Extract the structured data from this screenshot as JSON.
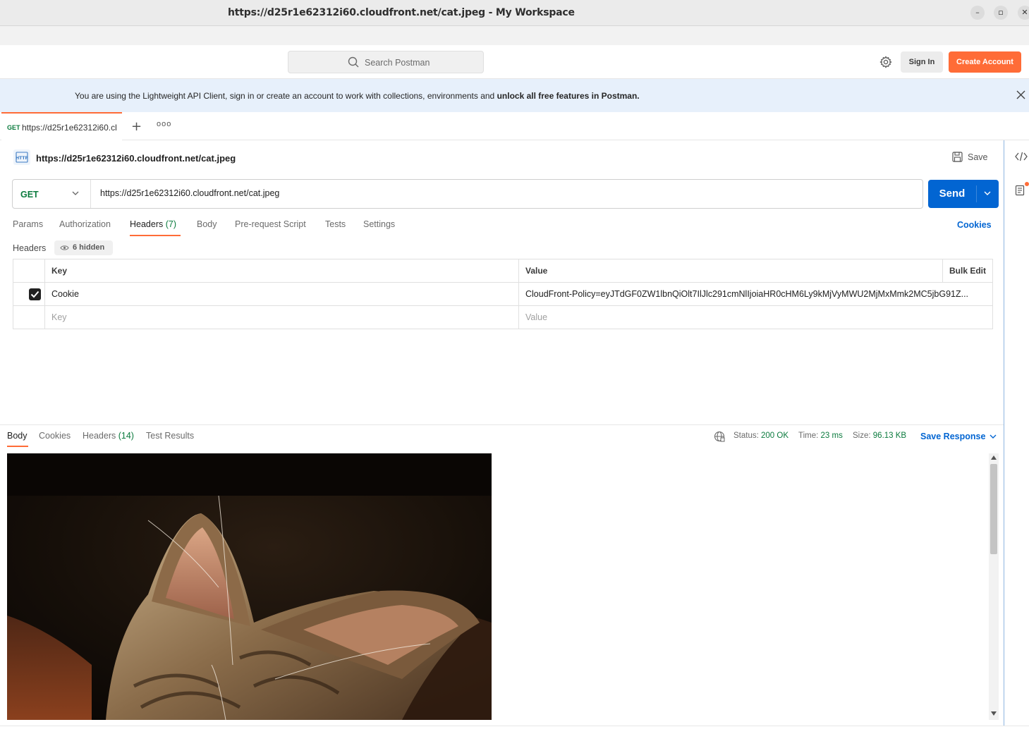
{
  "window": {
    "title": "https://d25r1e62312i60.cloudfront.net/cat.jpeg - My Workspace",
    "controls": [
      "minimize",
      "maximize",
      "close"
    ]
  },
  "header": {
    "search_placeholder": "Search Postman",
    "sign_in": "Sign In",
    "create_account": "Create Account"
  },
  "banner": {
    "text": "You are using the Lightweight API Client, sign in or create an account to work with collections, environments and ",
    "bold": "unlock all free features in Postman."
  },
  "tabs": {
    "active": {
      "method": "GET",
      "url": "https://d25r1e62312i60.cloudfront.net/cat.jpeg"
    }
  },
  "request": {
    "title": "https://d25r1e62312i60.cloudfront.net/cat.jpeg",
    "save": "Save",
    "method": "GET",
    "url": "https://d25r1e62312i60.cloudfront.net/cat.jpeg",
    "send": "Send",
    "subtabs": {
      "params": "Params",
      "authorization": "Authorization",
      "headers": "Headers",
      "headers_count": "(7)",
      "body": "Body",
      "prerequest": "Pre-request Script",
      "tests": "Tests",
      "settings": "Settings"
    },
    "cookies": "Cookies",
    "headers_label": "Headers",
    "hidden": "6 hidden",
    "table": {
      "col_key": "Key",
      "col_value": "Value",
      "bulk_edit": "Bulk Edit",
      "rows": [
        {
          "checked": true,
          "key": "Cookie",
          "value": "CloudFront-Policy=eyJTdGF0ZW1lbnQiOlt7IlJlc291cmNlIjoiaHR0cHM6Ly9kMjVyMWU2MjMxMmk2MC5jbG91Z..."
        }
      ],
      "key_placeholder": "Key",
      "value_placeholder": "Value"
    }
  },
  "response": {
    "tabs": {
      "body": "Body",
      "cookies": "Cookies",
      "headers": "Headers",
      "headers_count": "(14)",
      "test_results": "Test Results"
    },
    "status_label": "Status:",
    "status": "200 OK",
    "time_label": "Time:",
    "time": "23 ms",
    "size_label": "Size:",
    "size": "96.13 KB",
    "save_response": "Save Response"
  },
  "colors": {
    "accent": "#ff6c37",
    "primary": "#0265d2",
    "success": "#0b7b3e",
    "banner_bg": "#e7f0fb"
  }
}
